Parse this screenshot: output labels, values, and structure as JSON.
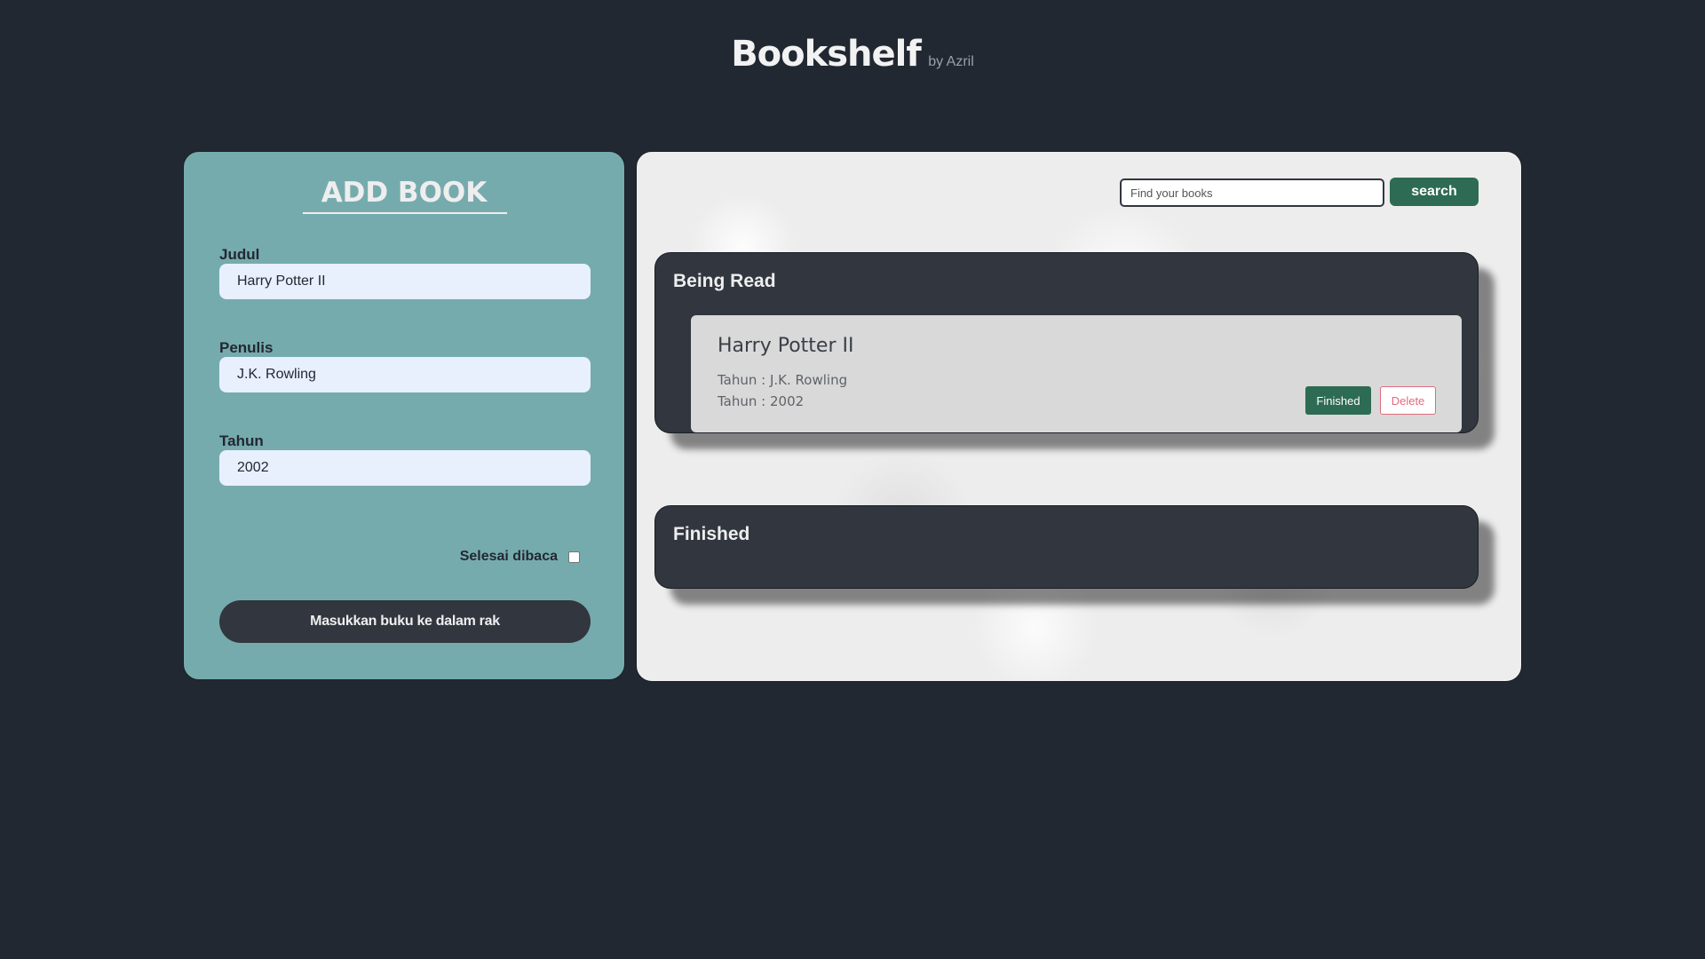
{
  "header": {
    "title": "Bookshelf",
    "byline": "by Azril"
  },
  "form": {
    "title": "ADD BOOK",
    "fields": [
      {
        "label": "Judul",
        "value": "Harry Potter II"
      },
      {
        "label": "Penulis",
        "value": "J.K. Rowling"
      },
      {
        "label": "Tahun",
        "value": "2002"
      }
    ],
    "done_label": "Selesai dibaca",
    "done_checked": false,
    "submit_label": "Masukkan buku ke dalam rak"
  },
  "search": {
    "placeholder": "Find your books",
    "button_label": "search"
  },
  "shelves": {
    "reading": {
      "title": "Being Read",
      "books": [
        {
          "title": "Harry Potter II",
          "author_line": "Tahun : J.K. Rowling",
          "year_line": "Tahun : 2002",
          "finish_label": "Finished",
          "delete_label": "Delete"
        }
      ]
    },
    "finished": {
      "title": "Finished",
      "books": []
    }
  },
  "colors": {
    "background": "#222831",
    "form_panel": "#76abae",
    "shelf": "#31363f",
    "accent_green": "#2e6b54",
    "delete_red": "#e06c7f"
  }
}
